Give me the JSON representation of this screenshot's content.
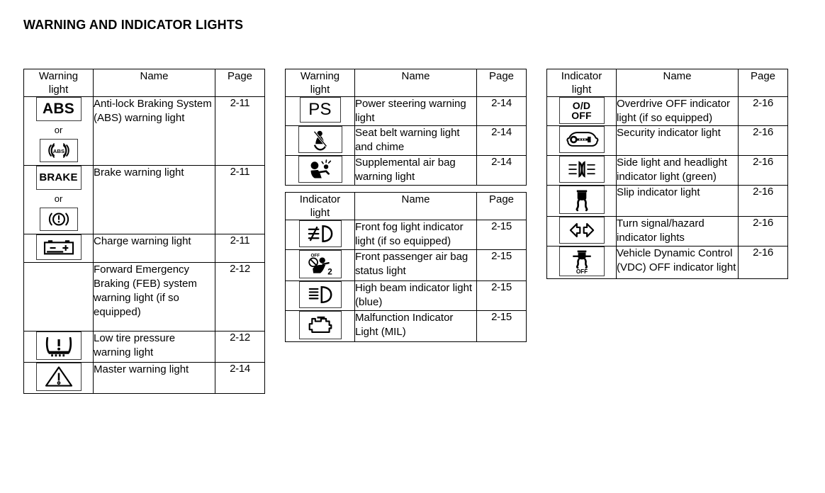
{
  "page": {
    "title": "WARNING AND INDICATOR LIGHTS"
  },
  "tables": [
    {
      "id": "warning-lights-table-1",
      "headers": {
        "icon_line1": "Warning",
        "icon_line2": "light",
        "name": "Name",
        "page": "Page"
      },
      "rows": [
        {
          "icon": "abs-text-symbol",
          "icon_alt": "abs-circle-symbol",
          "or_label": "or",
          "name": "Anti-lock Braking System (ABS) warning light",
          "page": "2-11"
        },
        {
          "icon": "brake-text-symbol",
          "icon_alt": "brake-exclamation-circle-symbol",
          "or_label": "or",
          "name": "Brake warning light",
          "page": "2-11"
        },
        {
          "icon": "battery-charge-symbol",
          "name": "Charge warning light",
          "page": "2-11"
        },
        {
          "icon": "none",
          "name": "Forward Emergency Braking (FEB) system warning light (if so equipped)",
          "page": "2-12"
        },
        {
          "icon": "tire-pressure-symbol",
          "name": "Low tire pressure warning light",
          "page": "2-12"
        },
        {
          "icon": "master-warning-triangle-symbol",
          "name": "Master warning light",
          "page": "2-14"
        }
      ]
    },
    {
      "id": "warning-lights-table-2",
      "headers": {
        "icon_line1": "Warning",
        "icon_line2": "light",
        "name": "Name",
        "page": "Page"
      },
      "rows": [
        {
          "icon": "power-steering-ps-symbol",
          "name": "Power steering warning light",
          "page": "2-14"
        },
        {
          "icon": "seat-belt-symbol",
          "name": "Seat belt warning light and chime",
          "page": "2-14"
        },
        {
          "icon": "air-bag-symbol",
          "name": "Supplemental air bag warning light",
          "page": "2-14"
        }
      ]
    },
    {
      "id": "indicator-lights-table-1",
      "headers": {
        "icon_line1": "Indicator",
        "icon_line2": "light",
        "name": "Name",
        "page": "Page"
      },
      "rows": [
        {
          "icon": "front-fog-light-symbol",
          "name": "Front fog light indicator light (if so equipped)",
          "page": "2-15"
        },
        {
          "icon": "passenger-air-bag-off-symbol",
          "name": "Front passenger air bag status light",
          "page": "2-15"
        },
        {
          "icon": "high-beam-symbol",
          "name": "High beam indicator light (blue)",
          "page": "2-15"
        },
        {
          "icon": "malfunction-engine-symbol",
          "name": "Malfunction Indicator Light (MIL)",
          "page": "2-15"
        }
      ]
    },
    {
      "id": "indicator-lights-table-2",
      "headers": {
        "icon_line1": "Indicator",
        "icon_line2": "light",
        "name": "Name",
        "page": "Page"
      },
      "rows": [
        {
          "icon": "overdrive-off-symbol",
          "name": "Overdrive OFF indicator light (if so equipped)",
          "page": "2-16"
        },
        {
          "icon": "security-key-car-symbol",
          "name": "Security indicator light",
          "page": "2-16"
        },
        {
          "icon": "side-headlight-symbol",
          "name": "Side light and headlight indicator light (green)",
          "page": "2-16"
        },
        {
          "icon": "slip-indicator-symbol",
          "name": "Slip indicator light",
          "page": "2-16"
        },
        {
          "icon": "turn-signal-hazard-symbol",
          "name": "Turn signal/hazard indicator lights",
          "page": "2-16"
        },
        {
          "icon": "vdc-off-symbol",
          "name": "Vehicle Dynamic Control (VDC) OFF indicator light",
          "page": "2-16"
        }
      ]
    }
  ],
  "icon_labels": {
    "abs": "ABS",
    "abs_small": "ABS",
    "brake": "BRAKE",
    "power_steering": "PS",
    "overdrive_line1": "O/D",
    "overdrive_line2": "OFF",
    "vdc_off": "OFF",
    "passenger_off": "OFF",
    "passenger_two": "2"
  },
  "colors": {
    "ink": "#000000",
    "rule": "#000000",
    "tile_border": "#3a3a3a",
    "page_background": "#ffffff"
  }
}
